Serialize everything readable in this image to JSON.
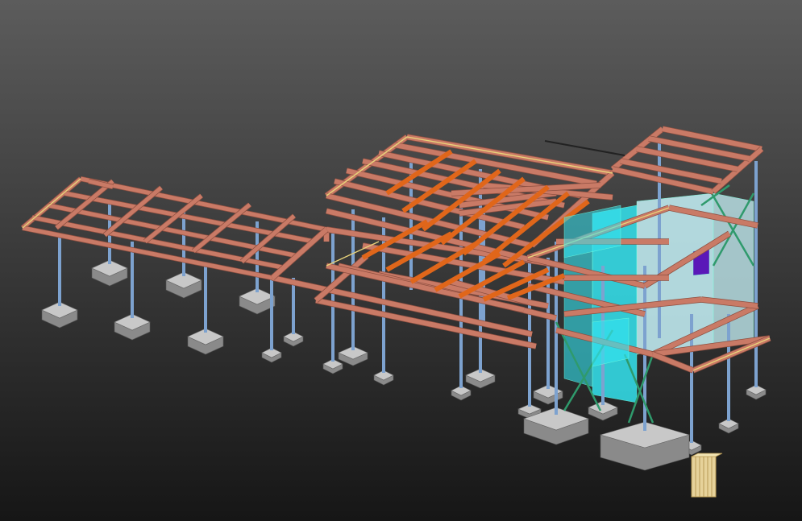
{
  "viewport": {
    "background_top": "#5c5c5c",
    "background_bottom": "#161616"
  },
  "model": {
    "colors": {
      "beam": "#c97a66",
      "beam_dark": "#8e4f40",
      "joist": "#e0661a",
      "column": "#7da2cf",
      "brace": "#2f9a6c",
      "footing_top": "#c8c8c8",
      "footing_side": "#8a8a8a",
      "glass": "#34e4f0",
      "glass_light": "#bfe9ee",
      "panel_purple": "#5a18b8",
      "timber": "#e6d29a",
      "timber_line": "#b89a55",
      "edge_yellow": "#e8d27a"
    },
    "element_types": [
      "beam",
      "joist",
      "column",
      "brace",
      "footing",
      "glazing",
      "timber-pile"
    ]
  }
}
